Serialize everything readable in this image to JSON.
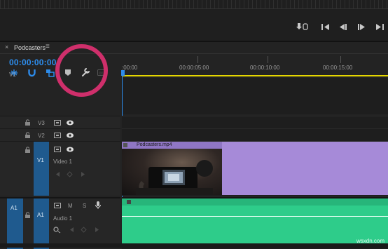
{
  "panel": {
    "close_symbol": "×",
    "title": "Podcasters",
    "menu_symbol": "≡"
  },
  "timecode": "00:00:00:00",
  "ruler": {
    "ticks": [
      ":00:00",
      "00:00:05:00",
      "00:00:10:00",
      "00:00:15:00"
    ]
  },
  "tracks": {
    "v3": {
      "label": "V3"
    },
    "v2": {
      "label": "V2"
    },
    "v1": {
      "source": "V1",
      "label": "V1",
      "name": "Video 1"
    },
    "a1": {
      "source": "A1",
      "label": "A1",
      "name": "Audio 1",
      "mute": "M",
      "solo": "S"
    }
  },
  "clips": {
    "video": {
      "name": "Podcasters.mp4"
    }
  },
  "watermark": "wsxdn.com",
  "colors": {
    "accent_blue": "#2d8ceb",
    "track_blue": "#1f5a8e",
    "video_clip": "#a68ad8",
    "audio_clip": "#2ecc8a",
    "highlight_circle": "#cf2f6b",
    "playhead_bar": "#e5d600"
  }
}
